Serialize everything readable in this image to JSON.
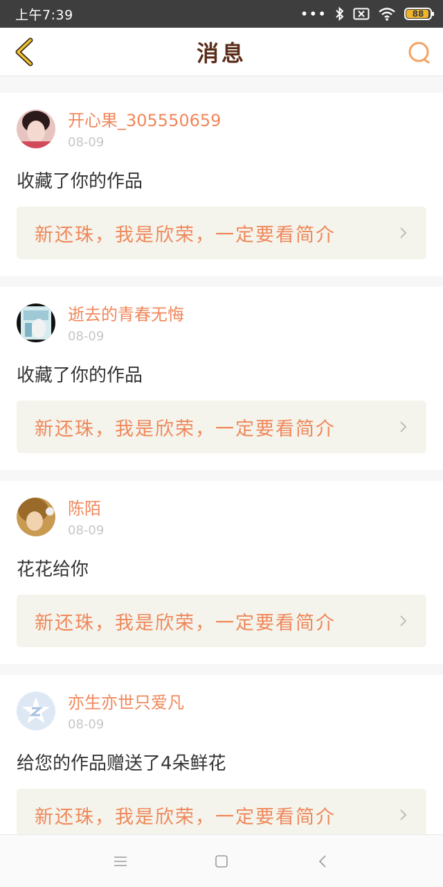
{
  "status": {
    "time": "上午7:39",
    "battery": "88"
  },
  "header": {
    "title": "消息"
  },
  "messages": [
    {
      "username": "开心果_305550659",
      "date": "08-09",
      "action": "收藏了你的作品",
      "work_title": "新还珠，我是欣荣，一定要看简介",
      "avatar": "avatar-1"
    },
    {
      "username": "逝去的青春无悔",
      "date": "08-09",
      "action": "收藏了你的作品",
      "work_title": "新还珠，我是欣荣，一定要看简介",
      "avatar": "avatar-2"
    },
    {
      "username": "陈陌",
      "date": "08-09",
      "action": "花花给你",
      "work_title": "新还珠，我是欣荣，一定要看简介",
      "avatar": "avatar-3"
    },
    {
      "username": "亦生亦世只爱凡",
      "date": "08-09",
      "action": "给您的作品赠送了4朵鲜花",
      "work_title": "新还珠，我是欣荣，一定要看简介",
      "avatar": "avatar-4"
    }
  ],
  "colors": {
    "accent": "#f0875a",
    "title": "#5a2d1a",
    "card_bg": "#f4f4ec"
  }
}
